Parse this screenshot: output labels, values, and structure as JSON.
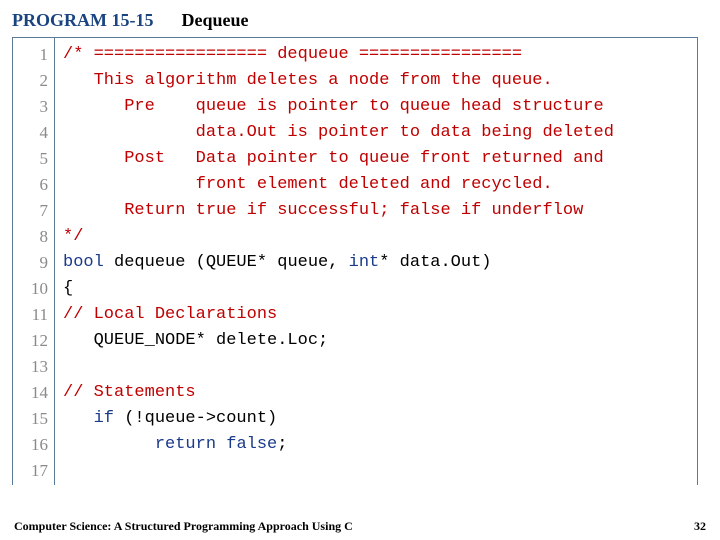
{
  "header": {
    "program_label": "PROGRAM 15-15",
    "program_title": "Dequeue"
  },
  "code": {
    "line_count": 17,
    "lines": [
      [
        {
          "cls": "c-comment",
          "t": "/* ================= dequeue ================"
        }
      ],
      [
        {
          "cls": "c-comment",
          "t": "   This algorithm deletes a node from the queue."
        }
      ],
      [
        {
          "cls": "c-comment",
          "t": "      Pre    queue is pointer to queue head structure"
        }
      ],
      [
        {
          "cls": "c-comment",
          "t": "             data.Out is pointer to data being deleted"
        }
      ],
      [
        {
          "cls": "c-comment",
          "t": "      Post   Data pointer to queue front returned and"
        }
      ],
      [
        {
          "cls": "c-comment",
          "t": "             front element deleted and recycled."
        }
      ],
      [
        {
          "cls": "c-comment",
          "t": "      Return true if successful; false if underflow"
        }
      ],
      [
        {
          "cls": "c-comment",
          "t": "*/"
        }
      ],
      [
        {
          "cls": "c-type",
          "t": "bool"
        },
        {
          "cls": "c-plain",
          "t": " dequeue (QUEUE* queue, "
        },
        {
          "cls": "c-type",
          "t": "int"
        },
        {
          "cls": "c-plain",
          "t": "* data.Out)"
        }
      ],
      [
        {
          "cls": "c-plain",
          "t": "{"
        }
      ],
      [
        {
          "cls": "c-comment",
          "t": "// Local Declarations"
        }
      ],
      [
        {
          "cls": "c-plain",
          "t": "   QUEUE_NODE* delete.Loc;"
        }
      ],
      [
        {
          "cls": "c-plain",
          "t": ""
        }
      ],
      [
        {
          "cls": "c-comment",
          "t": "// Statements"
        }
      ],
      [
        {
          "cls": "c-plain",
          "t": "   "
        },
        {
          "cls": "c-keyword",
          "t": "if"
        },
        {
          "cls": "c-plain",
          "t": " (!queue->count)"
        }
      ],
      [
        {
          "cls": "c-plain",
          "t": "         "
        },
        {
          "cls": "c-keyword",
          "t": "return"
        },
        {
          "cls": "c-plain",
          "t": " "
        },
        {
          "cls": "c-keyword",
          "t": "false"
        },
        {
          "cls": "c-plain",
          "t": ";"
        }
      ],
      [
        {
          "cls": "c-plain",
          "t": ""
        }
      ]
    ]
  },
  "footer": {
    "book_title": "Computer Science: A Structured Programming Approach Using C",
    "page_number": "32"
  }
}
